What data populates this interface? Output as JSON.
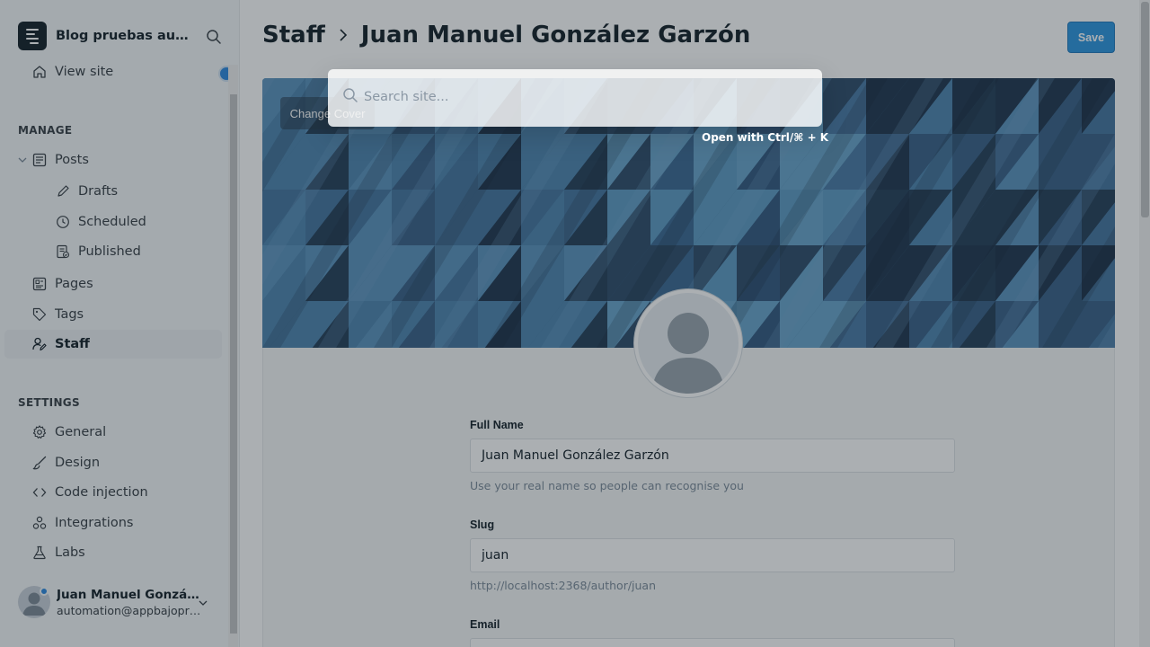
{
  "sidebar": {
    "site_title": "Blog pruebas automatizadas",
    "view_site": "View site",
    "manage_title": "MANAGE",
    "settings_title": "SETTINGS",
    "items": {
      "posts": "Posts",
      "drafts": "Drafts",
      "scheduled": "Scheduled",
      "published": "Published",
      "pages": "Pages",
      "tags": "Tags",
      "staff": "Staff",
      "general": "General",
      "design": "Design",
      "code_injection": "Code injection",
      "integrations": "Integrations",
      "labs": "Labs"
    },
    "user": {
      "name": "Juan Manuel González Garzón",
      "email": "automation@appbajopruebas.com"
    }
  },
  "header": {
    "breadcrumb_parent": "Staff",
    "breadcrumb_current": "Juan Manuel González Garzón",
    "save_label": "Save"
  },
  "cover": {
    "change_cover_label": "Change Cover"
  },
  "form": {
    "full_name_label": "Full Name",
    "full_name_value": "Juan Manuel González Garzón",
    "full_name_hint": "Use your real name so people can recognise you",
    "slug_label": "Slug",
    "slug_value": "juan",
    "slug_hint": "http://localhost:2368/author/juan",
    "email_label": "Email"
  },
  "search": {
    "placeholder": "Search site...",
    "hint": "Open with Ctrl/⌘ + K"
  },
  "colors": {
    "accent": "#2e97e0",
    "dark": "#15212a",
    "status_dot": "#2f8ae0"
  }
}
